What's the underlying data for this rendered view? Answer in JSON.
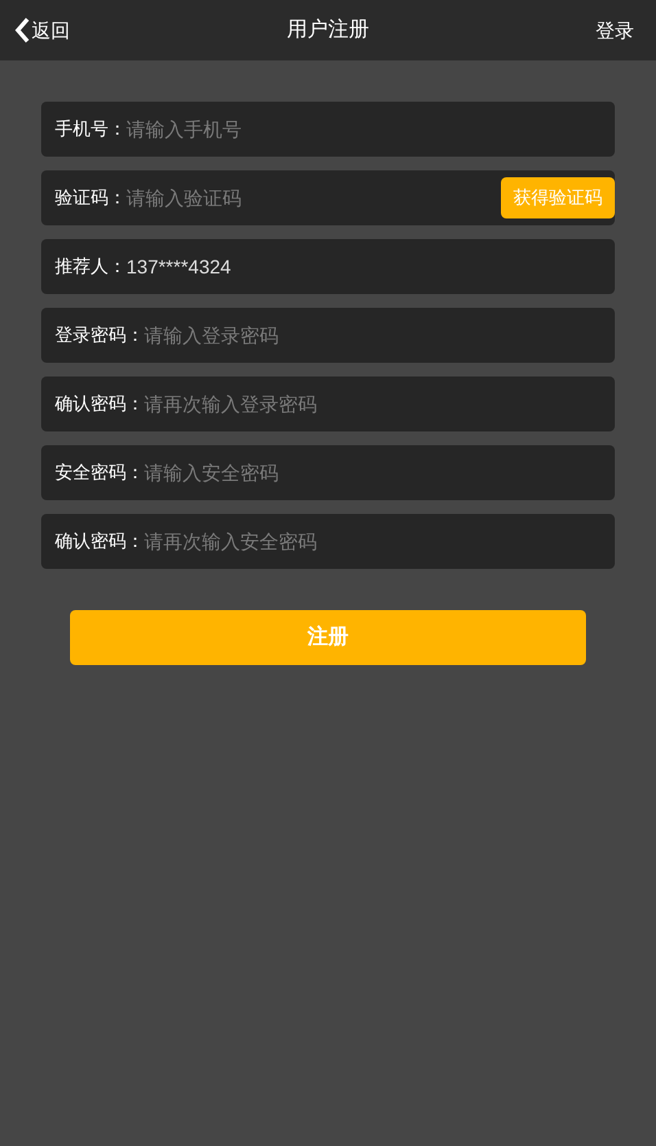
{
  "header": {
    "back": "返回",
    "title": "用户注册",
    "login": "登录"
  },
  "fields": [
    {
      "kind": "text",
      "label": "手机号：",
      "placeholder": "请输入手机号"
    },
    {
      "kind": "code",
      "label": "验证码：",
      "placeholder": "请输入验证码",
      "button": "获得验证码"
    },
    {
      "kind": "text",
      "label": "推荐人：",
      "value": "137****4324"
    },
    {
      "kind": "text",
      "label": "登录密码：",
      "placeholder": "请输入登录密码"
    },
    {
      "kind": "text",
      "label": "确认密码：",
      "placeholder": "请再次输入登录密码"
    },
    {
      "kind": "text",
      "label": "安全密码：",
      "placeholder": "请输入安全密码"
    },
    {
      "kind": "text",
      "label": "确认密码：",
      "placeholder": "请再次输入安全密码"
    }
  ],
  "submit": "注册"
}
